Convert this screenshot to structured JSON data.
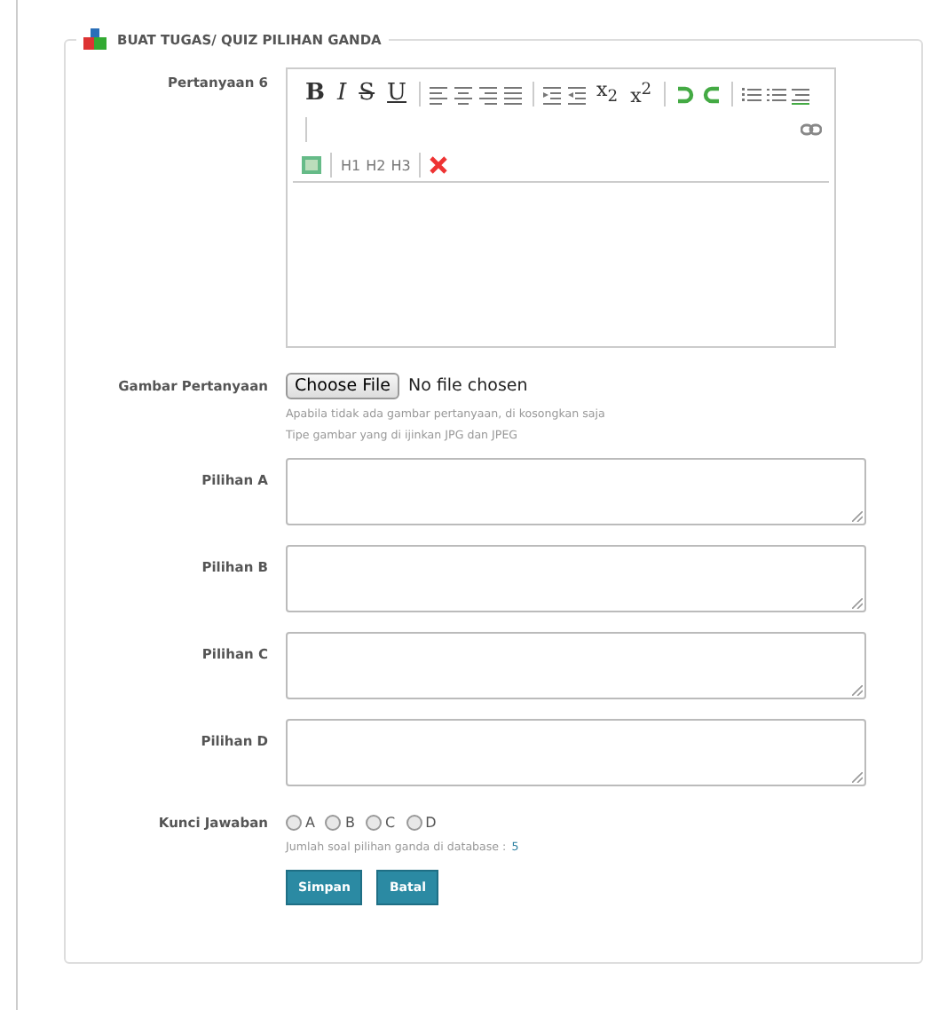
{
  "form": {
    "title": "BUAT TUGAS/ QUIZ PILIHAN GANDA",
    "question": {
      "label": "Pertanyaan 6",
      "format_buttons": [
        {
          "label": "B",
          "kind": "bold"
        },
        {
          "label": "I",
          "kind": "italic"
        },
        {
          "label": "S",
          "kind": "strike"
        },
        {
          "label": "U",
          "kind": "underline"
        }
      ],
      "script_buttons": [
        {
          "label": "x$_{2}$"
        },
        {
          "label": "x$^{2}$"
        }
      ],
      "heading_buttons": [
        "H1",
        "H2",
        "H3"
      ]
    },
    "image": {
      "label": "Gambar Pertanyaan",
      "button": "Choose File",
      "status": "No file chosen",
      "hints": [
        "Apabila tidak ada gambar pertanyaan, di kosongkan saja",
        "Tipe gambar yang di ijinkan JPG dan JPEG"
      ]
    },
    "choices": [
      {
        "label": "Pilihan A"
      },
      {
        "label": "Pilihan B"
      },
      {
        "label": "Pilihan C"
      },
      {
        "label": "Pilihan D"
      }
    ],
    "answer_key": {
      "label": "Kunci Jawaban",
      "options": [
        {
          "label": "A",
          "selected": false
        },
        {
          "label": "B",
          "selected": false
        },
        {
          "label": "C",
          "selected": false
        },
        {
          "label": "D",
          "selected": false
        }
      ],
      "count_label": "Jumlah soal pilihan ganda di database :",
      "count_value": "5"
    },
    "buttons": [
      "Simpan",
      "Batal"
    ]
  }
}
